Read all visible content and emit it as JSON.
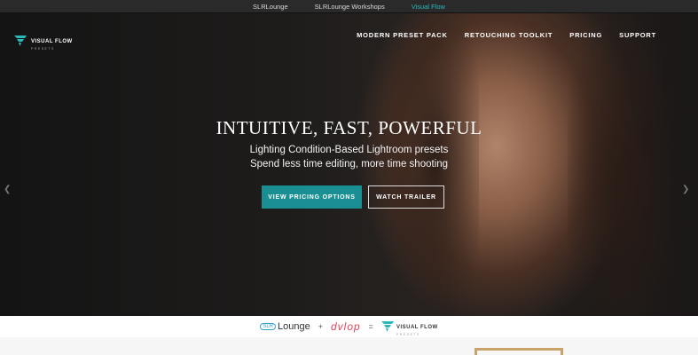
{
  "topbar": {
    "links": [
      "SLRLounge",
      "SLRLounge Workshops",
      "Visual Flow"
    ]
  },
  "logo": {
    "name": "VISUAL FLOW",
    "sub": "PRESETS"
  },
  "nav": {
    "items": [
      "MODERN PRESET PACK",
      "RETOUCHING TOOLKIT",
      "PRICING",
      "SUPPORT"
    ]
  },
  "hero": {
    "headline": "INTUITIVE, FAST, POWERFUL",
    "line1": "Lighting Condition-Based Lightroom presets",
    "line2": "Spend less time editing, more time shooting",
    "primary_button": "VIEW PRICING OPTIONS",
    "secondary_button": "WATCH TRAILER"
  },
  "partners": {
    "slr_badge": "SLR",
    "slr_text": "Lounge",
    "plus": "+",
    "dvlop": "dvlop",
    "equals": "=",
    "vf_name": "VISUAL FLOW",
    "vf_sub": "PRESETS"
  },
  "colors": {
    "accent": "#1a8f93",
    "topbar_active": "#2bb8bb",
    "gold": "#c9a46a"
  }
}
